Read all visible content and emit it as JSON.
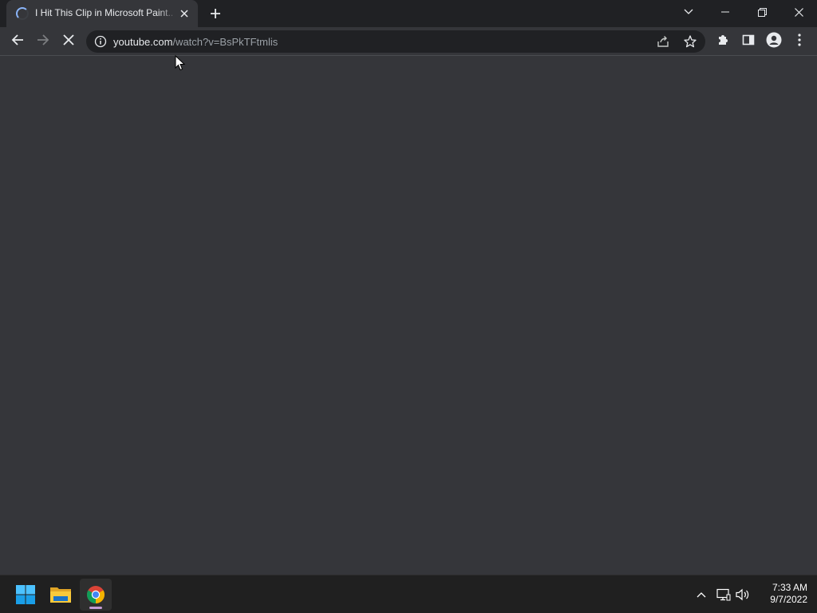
{
  "browser": {
    "tab": {
      "title": "I Hit This Clip in Microsoft Paint...",
      "state": "loading"
    },
    "address": {
      "host": "youtube.com",
      "path": "/watch?v=BsPkTFtmlis"
    },
    "icons": {
      "back": "arrow-left-icon",
      "forward": "arrow-right-icon",
      "stop": "close-icon",
      "info": "info-icon",
      "share": "share-icon",
      "bookmark": "star-icon",
      "extensions": "puzzle-icon",
      "side_panel": "side-panel-icon",
      "profile": "profile-icon",
      "menu": "more-vert-icon"
    }
  },
  "taskbar": {
    "apps": [
      {
        "name": "Start",
        "icon": "windows-icon"
      },
      {
        "name": "File Explorer",
        "icon": "folder-icon"
      },
      {
        "name": "Google Chrome",
        "icon": "chrome-icon",
        "active": true
      }
    ],
    "clock": {
      "time": "7:33 AM",
      "date": "9/7/2022"
    }
  },
  "colors": {
    "titlebar": "#202124",
    "toolbar": "#35363a",
    "omnibox": "#202124",
    "page": "#35363a",
    "taskbar": "#202020",
    "accent": "#8ab4f8"
  }
}
